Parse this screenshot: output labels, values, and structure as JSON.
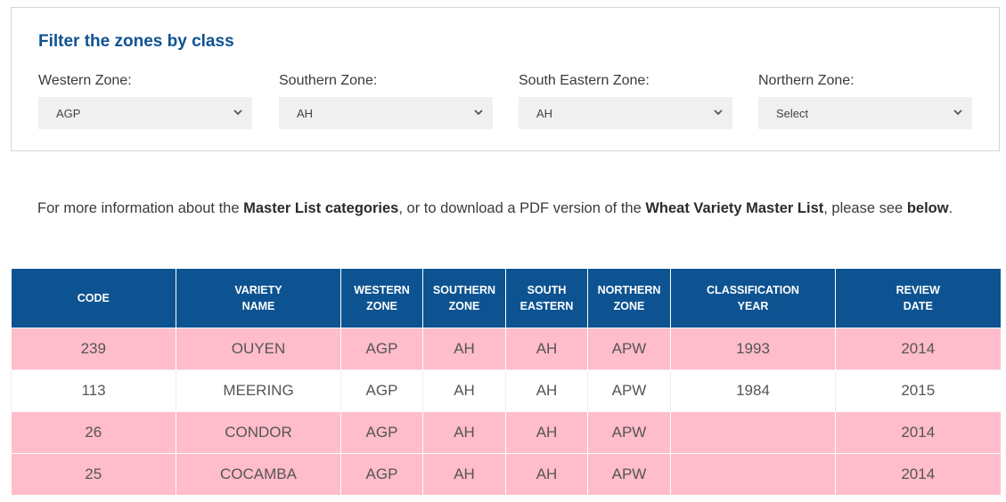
{
  "filter": {
    "title": "Filter the zones by class",
    "zones": [
      {
        "label": "Western Zone:",
        "value": "AGP"
      },
      {
        "label": "Southern Zone:",
        "value": "AH"
      },
      {
        "label": "South Eastern Zone:",
        "value": "AH"
      },
      {
        "label": "Northern Zone:",
        "value": "Select"
      }
    ],
    "chevron_icon": "chevron-down-icon"
  },
  "info": {
    "part1": "For more information about the ",
    "bold1": "Master List categories",
    "part2": ", or to download a PDF version of the ",
    "bold2": "Wheat Variety Master List",
    "part3": ", please see ",
    "bold3": "below",
    "part4": "."
  },
  "table": {
    "headers": [
      [
        "CODE"
      ],
      [
        "VARIETY",
        "NAME"
      ],
      [
        "WESTERN",
        "ZONE"
      ],
      [
        "SOUTHERN",
        "ZONE"
      ],
      [
        "SOUTH",
        "EASTERN"
      ],
      [
        "NORTHERN",
        "ZONE"
      ],
      [
        "CLASSIFICATION",
        "YEAR"
      ],
      [
        "REVIEW",
        "DATE"
      ]
    ],
    "rows": [
      [
        "239",
        "OUYEN",
        "AGP",
        "AH",
        "AH",
        "APW",
        "1993",
        "2014"
      ],
      [
        "113",
        "MEERING",
        "AGP",
        "AH",
        "AH",
        "APW",
        "1984",
        "2015"
      ],
      [
        "26",
        "CONDOR",
        "AGP",
        "AH",
        "AH",
        "APW",
        "",
        "2014"
      ],
      [
        "25",
        "COCAMBA",
        "AGP",
        "AH",
        "AH",
        "APW",
        "",
        "2014"
      ]
    ]
  },
  "colors": {
    "brand_blue": "#0d5391",
    "row_highlight": "#ffbcca",
    "select_bg": "#f0f0f0"
  }
}
